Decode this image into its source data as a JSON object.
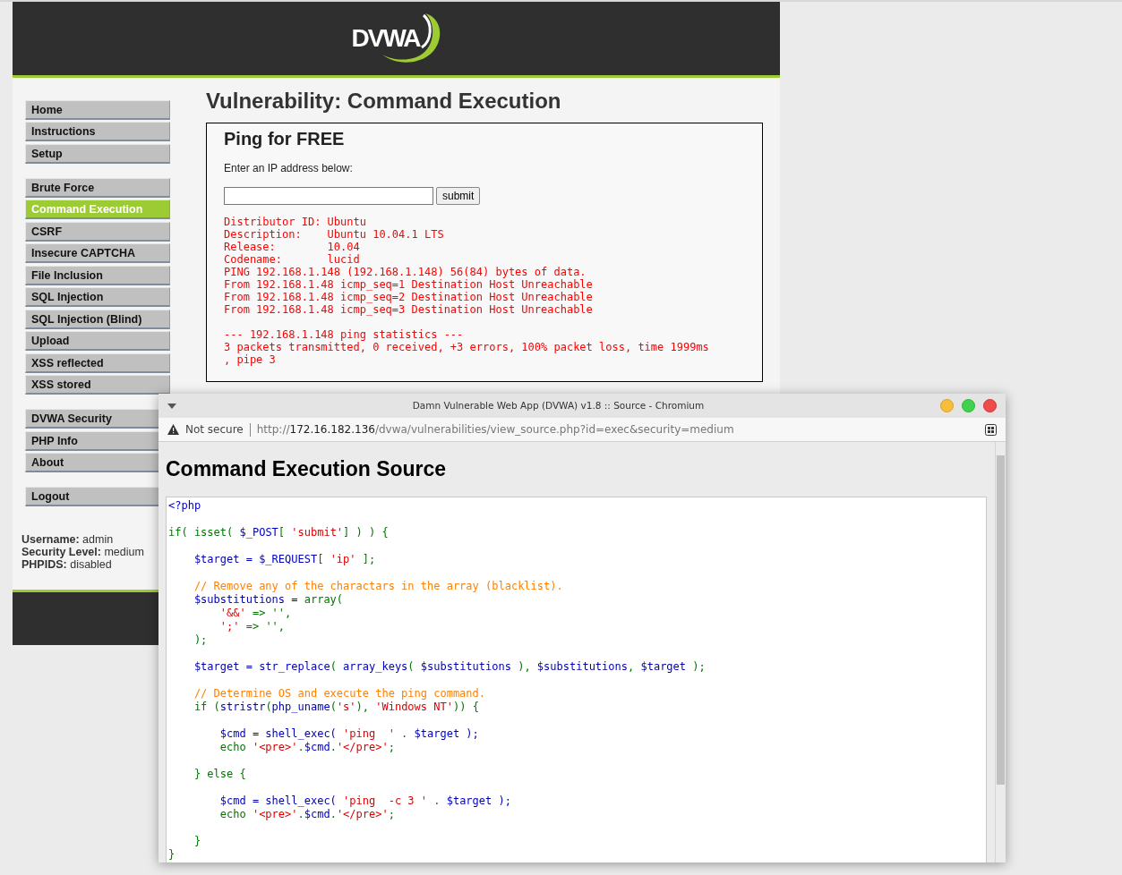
{
  "header": {
    "logo": "DVWA"
  },
  "sidebar": {
    "groups": [
      {
        "items": [
          {
            "label": "Home",
            "selected": false
          },
          {
            "label": "Instructions",
            "selected": false
          },
          {
            "label": "Setup",
            "selected": false
          }
        ]
      },
      {
        "items": [
          {
            "label": "Brute Force",
            "selected": false
          },
          {
            "label": "Command Execution",
            "selected": true
          },
          {
            "label": "CSRF",
            "selected": false
          },
          {
            "label": "Insecure CAPTCHA",
            "selected": false
          },
          {
            "label": "File Inclusion",
            "selected": false
          },
          {
            "label": "SQL Injection",
            "selected": false
          },
          {
            "label": "SQL Injection (Blind)",
            "selected": false
          },
          {
            "label": "Upload",
            "selected": false
          },
          {
            "label": "XSS reflected",
            "selected": false
          },
          {
            "label": "XSS stored",
            "selected": false
          }
        ]
      },
      {
        "items": [
          {
            "label": "DVWA Security",
            "selected": false
          },
          {
            "label": "PHP Info",
            "selected": false
          },
          {
            "label": "About",
            "selected": false
          }
        ]
      },
      {
        "items": [
          {
            "label": "Logout",
            "selected": false
          }
        ]
      }
    ]
  },
  "user_info": [
    "**Username:** admin",
    "**Security Level:** medium",
    "**PHPIDS:** disabled"
  ],
  "main": {
    "title": "Vulnerability: Command Execution",
    "panel": {
      "title": "Ping for FREE",
      "prompt": "Enter an IP address below:",
      "submit_button": "submit",
      "output": [
        [
          "Distributor ID: Ubuntu",
          "Description:    Ubuntu 10.04.1 LTS",
          "Release:        10.04",
          "Codename:       lucid",
          "PING 192.168.1.148 (192.168.1.148) 56(84) bytes of data.",
          "From 192.168.1.48 icmp_seq=1 Destination Host Unreachable",
          "From 192.168.1.48 icmp_seq=2 Destination Host Unreachable",
          "From 192.168.1.48 icmp_seq=3 Destination Host Unreachable"
        ],
        [
          "--- 192.168.1.148 ping statistics ---",
          "3 packets transmitted, 0 received, +3 errors, 100% packet loss, time 1999ms",
          ", pipe 3"
        ]
      ]
    }
  },
  "popup": {
    "title": "Damn Vulnerable Web App (DVWA) v1.8 :: Source - Chromium",
    "address_bar": {
      "security": "Not secure",
      "url": {
        "scheme": "http://",
        "host": "172.16.182.136",
        "path": "/dvwa/vulnerabilities/view_source.php?id=exec&security=medium"
      }
    },
    "heading": "Command Execution Source",
    "code": [
      [
        [
          {
            "kind": "default",
            "text": "<?php"
          }
        ]
      ],
      [
        [
          {
            "kind": "keyword",
            "text": "if( isset( "
          },
          {
            "kind": "default",
            "text": "$_POST"
          },
          {
            "kind": "keyword",
            "text": "[ "
          },
          {
            "kind": "string",
            "text": "'submit'"
          },
          {
            "kind": "keyword",
            "text": "] ) ) {"
          }
        ]
      ],
      [
        [
          {
            "kind": "default",
            "text": "    $target = $_REQUEST"
          },
          {
            "kind": "keyword",
            "text": "[ "
          },
          {
            "kind": "string",
            "text": "'ip'"
          },
          {
            "kind": "keyword",
            "text": " ];"
          }
        ]
      ],
      [
        [
          {
            "kind": "comment",
            "text": "    // Remove any of the charactars in the array (blacklist)."
          }
        ],
        [
          {
            "kind": "default",
            "text": "    $substitutions = "
          },
          {
            "kind": "keyword",
            "text": "array("
          }
        ],
        [
          {
            "kind": "string",
            "text": "        '&&' "
          },
          {
            "kind": "keyword",
            "text": "=> '',"
          }
        ],
        [
          {
            "kind": "string",
            "text": "        ';' "
          },
          {
            "kind": "keyword",
            "text": "=> '',"
          }
        ],
        [
          {
            "kind": "keyword",
            "text": "    );"
          }
        ]
      ],
      [
        [
          {
            "kind": "default",
            "text": "    $target = str_replace"
          },
          {
            "kind": "keyword",
            "text": "( "
          },
          {
            "kind": "default",
            "text": "array_keys"
          },
          {
            "kind": "keyword",
            "text": "( "
          },
          {
            "kind": "default",
            "text": "$substitutions "
          },
          {
            "kind": "keyword",
            "text": "), "
          },
          {
            "kind": "default",
            "text": "$substitutions"
          },
          {
            "kind": "keyword",
            "text": ", "
          },
          {
            "kind": "default",
            "text": "$target "
          },
          {
            "kind": "keyword",
            "text": ");"
          }
        ]
      ],
      [
        [
          {
            "kind": "comment",
            "text": "    // Determine OS and execute the ping command."
          }
        ],
        [
          {
            "kind": "keyword",
            "text": "    if ("
          },
          {
            "kind": "default",
            "text": "stristr"
          },
          {
            "kind": "keyword",
            "text": "("
          },
          {
            "kind": "default",
            "text": "php_uname"
          },
          {
            "kind": "keyword",
            "text": "("
          },
          {
            "kind": "string",
            "text": "'s'"
          },
          {
            "kind": "keyword",
            "text": "), "
          },
          {
            "kind": "string",
            "text": "'Windows NT'"
          },
          {
            "kind": "keyword",
            "text": ")) {"
          }
        ]
      ],
      [
        [
          {
            "kind": "default",
            "text": "        $cmd = shell_exec( "
          },
          {
            "kind": "string",
            "text": "'ping  ' "
          },
          {
            "kind": "keyword",
            "text": ". "
          },
          {
            "kind": "default",
            "text": "$target );"
          }
        ],
        [
          {
            "kind": "keyword",
            "text": "        echo "
          },
          {
            "kind": "string",
            "text": "'<pre>'"
          },
          {
            "kind": "keyword",
            "text": "."
          },
          {
            "kind": "default",
            "text": "$cmd"
          },
          {
            "kind": "keyword",
            "text": "."
          },
          {
            "kind": "string",
            "text": "'</pre>'"
          },
          {
            "kind": "keyword",
            "text": ";"
          }
        ]
      ],
      [
        [
          {
            "kind": "keyword",
            "text": "    } else {"
          }
        ]
      ],
      [
        [
          {
            "kind": "default",
            "text": "        $cmd = shell_exec( "
          },
          {
            "kind": "string",
            "text": "'ping  -c 3 ' "
          },
          {
            "kind": "keyword",
            "text": ". "
          },
          {
            "kind": "default",
            "text": "$target );"
          }
        ],
        [
          {
            "kind": "keyword",
            "text": "        echo "
          },
          {
            "kind": "string",
            "text": "'<pre>'"
          },
          {
            "kind": "keyword",
            "text": "."
          },
          {
            "kind": "default",
            "text": "$cmd"
          },
          {
            "kind": "keyword",
            "text": "."
          },
          {
            "kind": "string",
            "text": "'</pre>'"
          },
          {
            "kind": "keyword",
            "text": ";"
          }
        ]
      ],
      [
        [
          {
            "kind": "keyword",
            "text": "    }"
          }
        ],
        [
          {
            "kind": "keyword",
            "text": "}"
          }
        ]
      ]
    ]
  }
}
